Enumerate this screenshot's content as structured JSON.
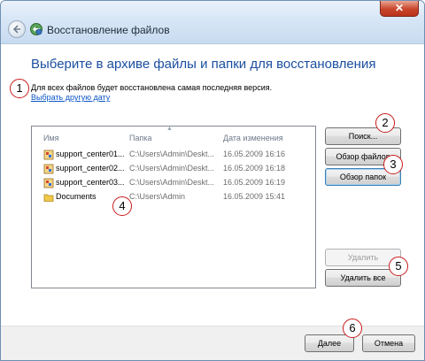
{
  "window": {
    "title": "Восстановление файлов",
    "close_label": "✕"
  },
  "main": {
    "heading": "Выберите в архиве файлы и папки для восстановления",
    "info_text": "Для всех файлов будет восстановлена самая последняя версия.",
    "choose_date_link": "Выбрать другую дату"
  },
  "list": {
    "columns": {
      "name": "Имя",
      "folder": "Папка",
      "date": "Дата изменения"
    },
    "rows": [
      {
        "name": "support_center01...",
        "folder": "C:\\Users\\Admin\\Deskt...",
        "date": "16.05.2009 16:16",
        "icon": "file-archive-icon"
      },
      {
        "name": "support_center02...",
        "folder": "C:\\Users\\Admin\\Deskt...",
        "date": "16.05.2009 16:18",
        "icon": "file-archive-icon"
      },
      {
        "name": "support_center03...",
        "folder": "C:\\Users\\Admin\\Deskt...",
        "date": "16.05.2009 16:19",
        "icon": "file-archive-icon"
      },
      {
        "name": "Documents",
        "folder": "C:\\Users\\Admin",
        "date": "16.05.2009 15:41",
        "icon": "folder-icon"
      }
    ]
  },
  "buttons": {
    "search": "Поиск...",
    "browse_files": "Обзор файлов",
    "browse_folders": "Обзор папок",
    "delete": "Удалить",
    "delete_all": "Удалить все",
    "next": "Далее",
    "cancel": "Отмена"
  },
  "callouts": [
    "1",
    "2",
    "3",
    "4",
    "5",
    "6"
  ],
  "colors": {
    "heading": "#1b4fa0",
    "link": "#0b56c6",
    "callout_border": "#c81c1c",
    "close_button": "#c9452a"
  }
}
